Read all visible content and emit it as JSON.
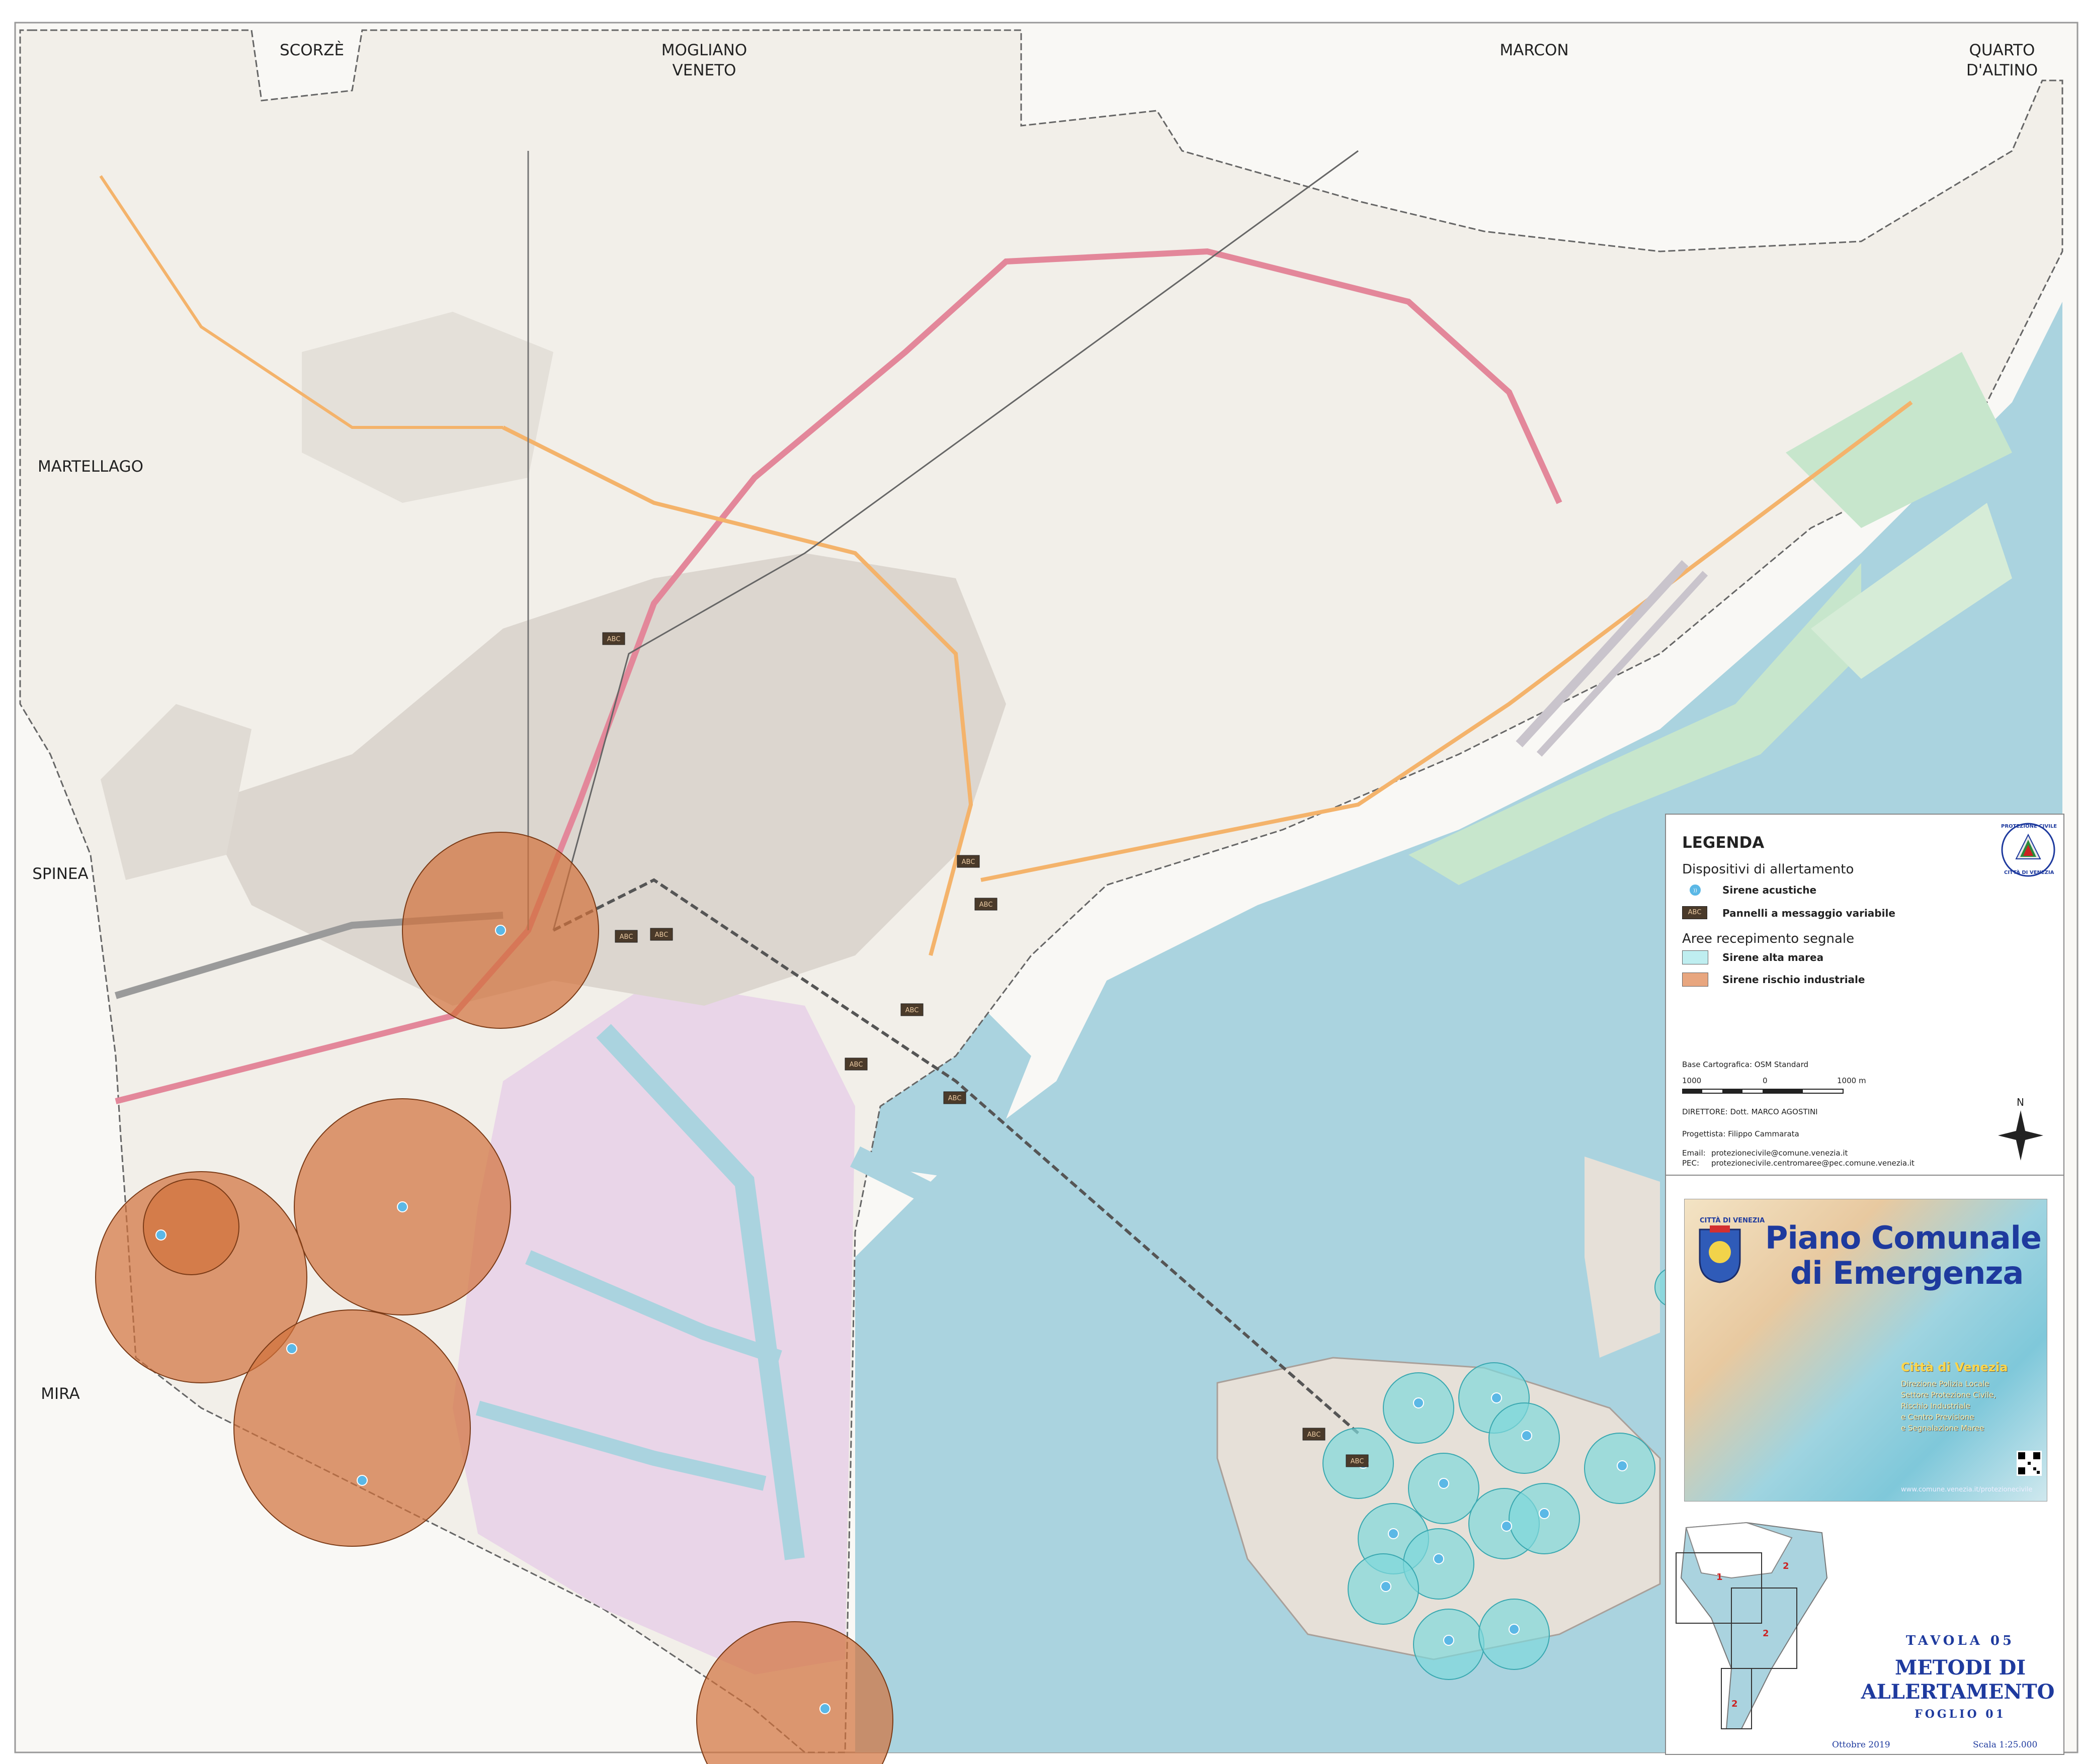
{
  "municipalities": {
    "scorze": "SCORZÈ",
    "mogliano": "MOGLIANO\nVENETO",
    "marcon": "MARCON",
    "quarto": "QUARTO\nD'ALTINO",
    "martellago": "MARTELLAGO",
    "spinea": "SPINEA",
    "mira": "MIRA"
  },
  "map_labels": {
    "pmv": "ABC"
  },
  "legend": {
    "title": "LEGENDA",
    "devices_header": "Dispositivi di allertamento",
    "sirens_label": "Sirene acustiche",
    "panels_label": "Pannelli a messaggio variabile",
    "areas_header": "Aree recepimento segnale",
    "tide_label": "Sirene alta marea",
    "industrial_label": "Sirene rischio industriale",
    "base_map": "Base Cartografica: OSM Standard",
    "scale_left": "1000",
    "scale_mid": "0",
    "scale_right": "1000 m",
    "director": "DIRETTORE: Dott. MARCO AGOSTINI",
    "designer": "Progettista:  Filippo Cammarata",
    "email_label": "Email:",
    "email_value": "protezionecivile@comune.venezia.it",
    "pec_label": "PEC:",
    "pec_value": "protezionecivile.centromaree@pec.comune.venezia.it",
    "north": "N",
    "pc_logo_top": "PROTEZIONE CIVILE",
    "pc_logo_bottom": "CITTÀ DI VENEZIA",
    "siren_icon": "siren-icon",
    "panel_icon": "abc-panel-icon"
  },
  "title_block": {
    "cover_logo": "CITTÀ DI VENEZIA",
    "cover_title_1": "Piano Comunale",
    "cover_title_2": "di Emergenza",
    "cover_city": "Città di Venezia",
    "cover_sub_1": "Direzione Polizia Locale",
    "cover_sub_2": "Settore Protezione Civile,",
    "cover_sub_3": "Rischio Industriale",
    "cover_sub_4": "e Centro Previsione",
    "cover_sub_5": "e Segnalazione Maree",
    "cover_url": "www.comune.venezia.it/protezionecivile",
    "tavola": "TAVOLA 05",
    "metodi_1": "METODI DI",
    "metodi_2": "ALLERTAMENTO",
    "foglio": "FOGLIO 01",
    "date": "Ottobre 2019",
    "scale": "Scala 1:25.000",
    "inset_1": "1",
    "inset_2": "2"
  },
  "colors": {
    "land": "#f2efe9",
    "water": "#aad3df",
    "industrial": "#e9d5e8",
    "motorway": "#e3879a",
    "main_road": "#f4b36b",
    "industrial_circle": "#d2703a",
    "tide_circle": "#7fd8dc",
    "boundary": "#555555"
  }
}
